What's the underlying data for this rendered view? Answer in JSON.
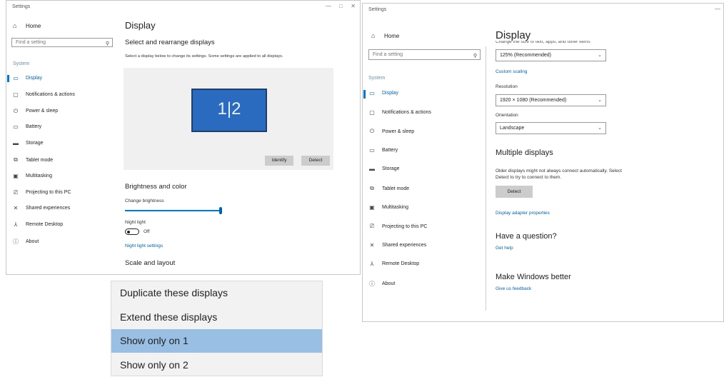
{
  "left_window": {
    "title": "Settings",
    "home": "Home",
    "search_placeholder": "Find a setting",
    "section": "System",
    "nav": [
      "Display",
      "Notifications & actions",
      "Power & sleep",
      "Battery",
      "Storage",
      "Tablet mode",
      "Multitasking",
      "Projecting to this PC",
      "Shared experiences",
      "Remote Desktop",
      "About"
    ],
    "nav_icons": [
      "monitor-icon",
      "message-icon",
      "power-icon",
      "battery-icon",
      "storage-icon",
      "tablet-icon",
      "multitask-icon",
      "project-icon",
      "share-icon",
      "remote-icon",
      "info-icon"
    ],
    "selected_index": 0,
    "page_title": "Display",
    "rearrange_heading": "Select and rearrange displays",
    "rearrange_desc": "Select a display below to change its settings. Some settings are applied to all displays.",
    "monitor_label": "1|2",
    "identify_button": "Identify",
    "detect_button": "Detect",
    "brightness_heading": "Brightness and color",
    "brightness_label": "Change brightness",
    "brightness_value": 1.0,
    "night_light_label": "Night light",
    "night_light_state": "Off",
    "night_light_link": "Night light settings",
    "scale_heading": "Scale and layout"
  },
  "right_window": {
    "title": "Settings",
    "home": "Home",
    "search_placeholder": "Find a setting",
    "section": "System",
    "nav": [
      "Display",
      "Notifications & actions",
      "Power & sleep",
      "Battery",
      "Storage",
      "Tablet mode",
      "Multitasking",
      "Projecting to this PC",
      "Shared experiences",
      "Remote Desktop",
      "About"
    ],
    "nav_icons": [
      "monitor-icon",
      "message-icon",
      "power-icon",
      "battery-icon",
      "storage-icon",
      "tablet-icon",
      "multitask-icon",
      "project-icon",
      "share-icon",
      "remote-icon",
      "info-icon"
    ],
    "selected_index": 0,
    "page_title": "Display",
    "cut_text": "Change the size of text, apps, and other items",
    "scale_value": "125% (Recommended)",
    "custom_scaling": "Custom scaling",
    "resolution_label": "Resolution",
    "resolution_value": "1920 × 1080 (Recommended)",
    "orientation_label": "Orientation",
    "orientation_value": "Landscape",
    "multiple_heading": "Multiple displays",
    "multiple_desc_1": "Older displays might not always connect automatically. Select",
    "multiple_desc_2": "Detect to try to connect to them.",
    "detect_button": "Detect",
    "adapter_link": "Display adapter properties",
    "question_heading": "Have a question?",
    "get_help": "Get help",
    "better_heading": "Make Windows better",
    "feedback_link": "Give us feedback"
  },
  "project_menu": {
    "items": [
      "Duplicate these displays",
      "Extend these displays",
      "Show only on 1",
      "Show only on 2"
    ],
    "highlighted_index": 2
  }
}
